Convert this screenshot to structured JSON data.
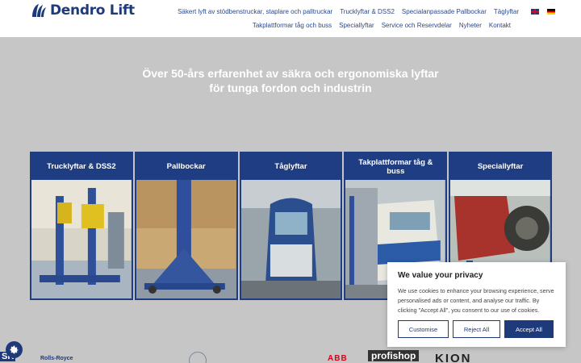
{
  "header": {
    "logo_text": "Dendro Lift",
    "nav_row1": [
      "Säkert lyft av stödbenstruckar, staplare och palltruckar",
      "Trucklyftar & DSS2",
      "Specialanpassade Pallbockar",
      "Täglyftar"
    ],
    "nav_row2": [
      "Takplattformar tåg och buss",
      "Speciallyftar",
      "Service och Reservdelar",
      "Nyheter",
      "Kontakt"
    ],
    "flags": [
      "uk-flag",
      "de-flag"
    ]
  },
  "hero": {
    "line1": "Över 50-års erfarenhet av säkra och ergonomiska lyftar",
    "line2": "för tunga fordon och industrin"
  },
  "cards": [
    {
      "title": "Trucklyftar & DSS2"
    },
    {
      "title": "Pallbockar"
    },
    {
      "title": "Tåglyftar"
    },
    {
      "title": "Takplattformar tåg & buss"
    },
    {
      "title": "Speciallyftar"
    }
  ],
  "cookie": {
    "title": "We value your privacy",
    "text": "We use cookies to enhance your browsing experience, serve personalised ads or content, and analyse our traffic. By clicking \"Accept All\", you consent to our use of cookies.",
    "customise": "Customise",
    "reject": "Reject All",
    "accept": "Accept All"
  },
  "partners": [
    "SK",
    "Rolls-Royce",
    "ABB",
    "profishop",
    "KION"
  ],
  "colors": {
    "brand": "#1f3a7a",
    "card": "#1f3d82",
    "hero_bg": "#c6c6c6"
  }
}
